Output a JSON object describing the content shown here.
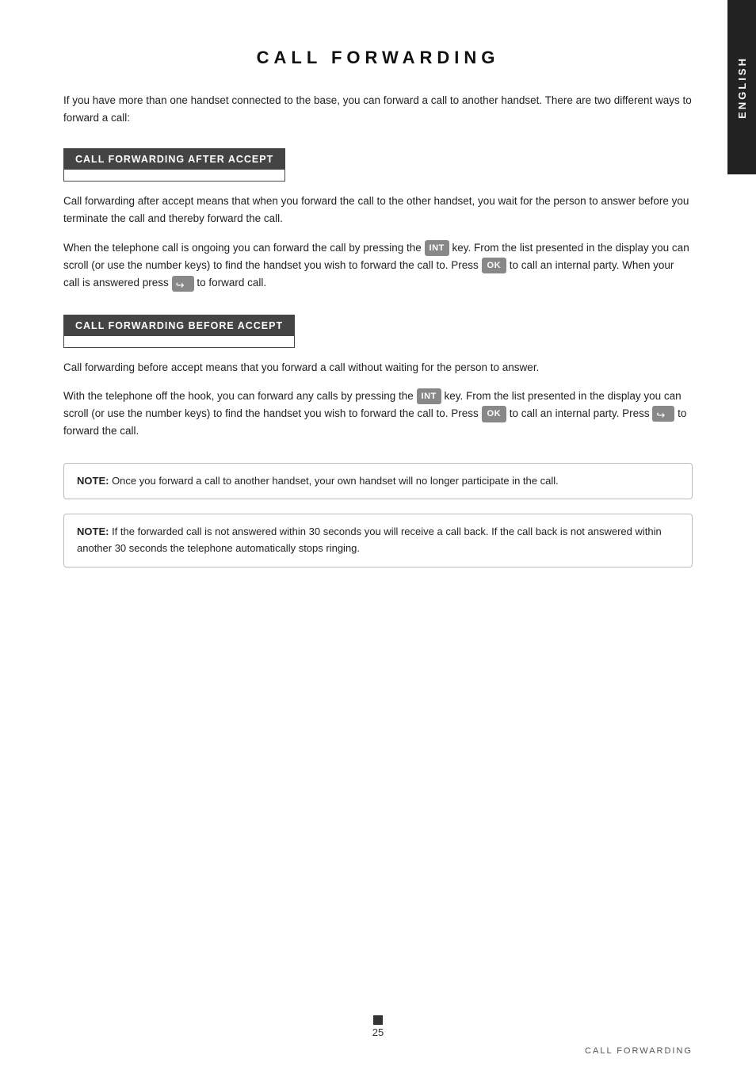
{
  "page": {
    "title": "CALL FORWARDING",
    "side_tab": "ENGLISH",
    "intro": "If you have more than one handset connected to the base, you can forward a call to another handset. There are two different ways to forward a call:",
    "section_after": {
      "header": "CALL FORWARDING AFTER ACCEPT",
      "paragraph1": "Call forwarding after accept means that when you forward the call to the other handset, you wait for the person to answer before you terminate the call and thereby forward the call.",
      "paragraph2_pre": "When the telephone call is ongoing you can forward the call by pressing the",
      "int_key": "INT",
      "paragraph2_mid1": " key. From the list presented in the display you can scroll (or use the number keys) to find the handset you wish to forward the call to. Press",
      "ok_key": "OK",
      "paragraph2_mid2": " to call an internal party. When your call is answered press",
      "paragraph2_post": " to forward call."
    },
    "section_before": {
      "header": "CALL FORWARDING BEFORE ACCEPT",
      "paragraph1": "Call forwarding before accept means that you forward a call without waiting for the person to answer.",
      "paragraph2_pre": "With the telephone off the hook, you can forward any calls by pressing the",
      "int_key": "INT",
      "paragraph2_mid1": " key. From the list presented in the display you can scroll (or use the number keys) to find the handset you wish to forward the call to. Press",
      "ok_key": "OK",
      "paragraph2_mid2": " to call an internal party. Press",
      "paragraph2_post": " to forward the call."
    },
    "note1": {
      "label": "NOTE:",
      "text": " Once you forward a call to another handset, your own handset will no longer participate in the call."
    },
    "note2": {
      "label": "NOTE:",
      "text": " If the forwarded call is not answered within 30 seconds you will receive a call back. If the call back is not answered within another 30 seconds the telephone automatically stops ringing."
    },
    "page_number": "25",
    "bottom_label": "CALL FORWARDING"
  }
}
